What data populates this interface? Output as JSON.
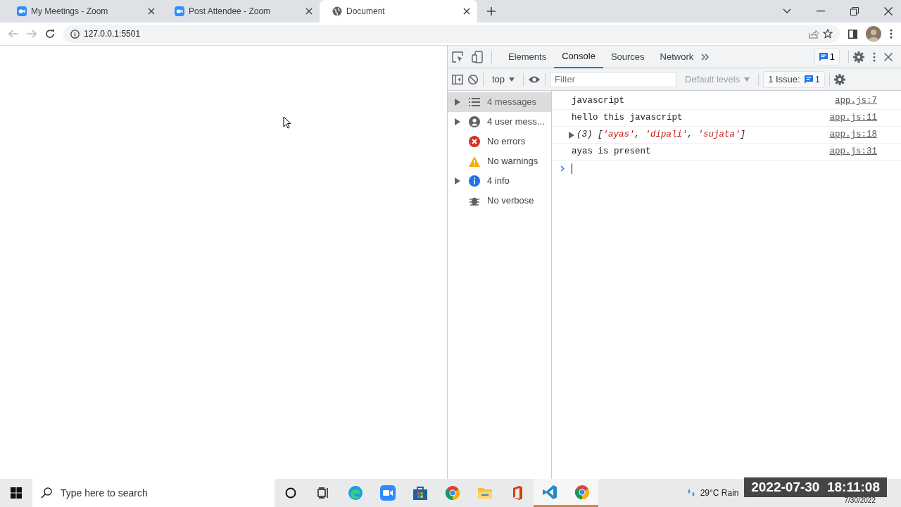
{
  "browser": {
    "tabs": [
      {
        "title": "My Meetings - Zoom",
        "kind": "zoom",
        "selected": false
      },
      {
        "title": "Post Attendee - Zoom",
        "kind": "zoom",
        "selected": false
      },
      {
        "title": "Document",
        "kind": "globe",
        "selected": true
      }
    ],
    "address": "127.0.0.1:5501"
  },
  "devtools": {
    "panel_tabs": [
      {
        "label": "Elements",
        "selected": false
      },
      {
        "label": "Console",
        "selected": true
      },
      {
        "label": "Sources",
        "selected": false
      },
      {
        "label": "Network",
        "selected": false
      }
    ],
    "message_count": "1",
    "context": "top",
    "filter_placeholder": "Filter",
    "levels": "Default levels",
    "issues_label": "1 Issue:",
    "issues_count": "1",
    "sidebar": [
      {
        "label": "4 messages",
        "kind": "list",
        "expandable": true,
        "selected": true
      },
      {
        "label": "4 user mess...",
        "kind": "user",
        "expandable": true,
        "selected": false
      },
      {
        "label": "No errors",
        "kind": "error",
        "expandable": false,
        "selected": false
      },
      {
        "label": "No warnings",
        "kind": "warning",
        "expandable": false,
        "selected": false
      },
      {
        "label": "4 info",
        "kind": "info",
        "expandable": true,
        "selected": false
      },
      {
        "label": "No verbose",
        "kind": "bug",
        "expandable": false,
        "selected": false
      }
    ],
    "messages": [
      {
        "kind": "text",
        "text": "javascript",
        "source": "app.js:7"
      },
      {
        "kind": "text",
        "text": "hello this javascript",
        "source": "app.js:11"
      },
      {
        "kind": "array",
        "parts": [
          {
            "kind": "punct",
            "text": "(3) ["
          },
          {
            "kind": "string",
            "text": "'ayas'"
          },
          {
            "kind": "punct",
            "text": ", "
          },
          {
            "kind": "string",
            "text": "'dipali'"
          },
          {
            "kind": "punct",
            "text": ", "
          },
          {
            "kind": "string",
            "text": "'sujata'"
          },
          {
            "kind": "punct",
            "text": "]"
          }
        ],
        "source": "app.js:18"
      },
      {
        "kind": "text",
        "text": "ayas is present",
        "source": "app.js:31"
      }
    ]
  },
  "taskbar": {
    "search_placeholder": "Type here to search",
    "apps": [
      {
        "kind": "edge",
        "active": false
      },
      {
        "kind": "zoom",
        "active": false
      },
      {
        "kind": "store",
        "active": false
      },
      {
        "kind": "chrome",
        "active": false
      },
      {
        "kind": "folder",
        "active": false
      },
      {
        "kind": "office",
        "active": false
      },
      {
        "kind": "vscode",
        "active": true
      },
      {
        "kind": "chrome",
        "active": true
      }
    ],
    "weather": "29°C Rain",
    "date": "7/30/2022"
  },
  "recording_timestamp": "2022-07-30  18:11:08"
}
